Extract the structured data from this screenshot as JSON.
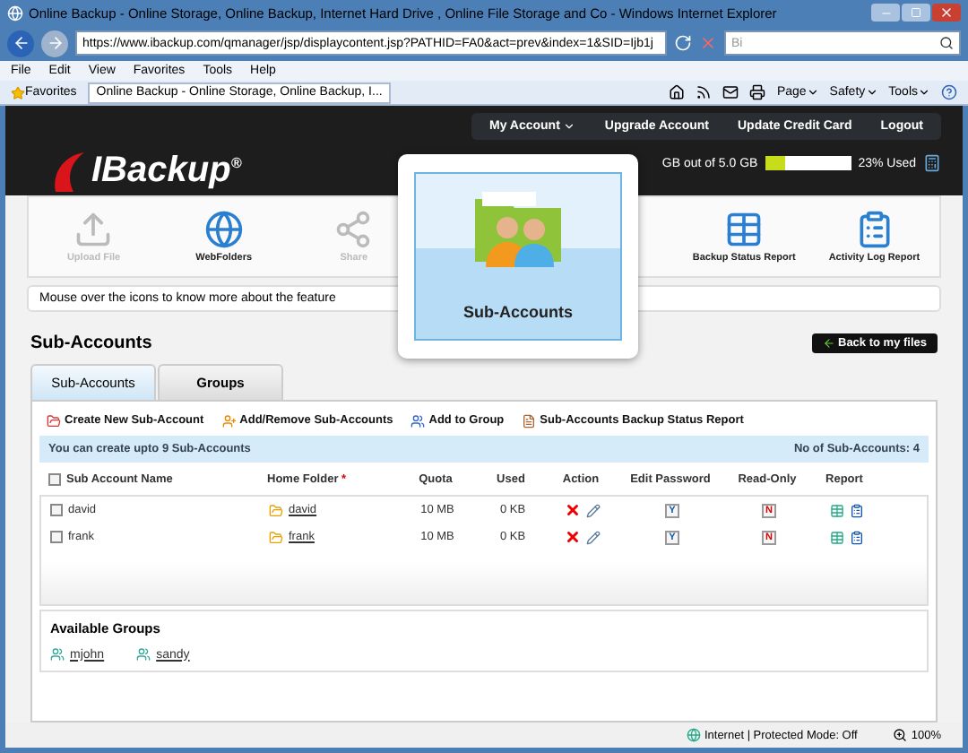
{
  "window": {
    "title": "Online Backup - Online Storage, Online Backup, Internet Hard Drive , Online File Storage and Co - Windows Internet Explorer"
  },
  "address_bar": {
    "url": "https://www.ibackup.com/qmanager/jsp/displaycontent.jsp?PATHID=FA0&act=prev&index=1&SID=Ijb1j",
    "search_placeholder": "Bi"
  },
  "menu": [
    "File",
    "Edit",
    "View",
    "Favorites",
    "Tools",
    "Help"
  ],
  "favorites_bar": {
    "favorites": "Favorites",
    "tab": "Online Backup - Online Storage, Online Backup, I...",
    "commands": [
      "Page",
      "Safety",
      "Tools"
    ]
  },
  "site": {
    "logo": "IBackup",
    "logo_mark": "®",
    "nav": [
      {
        "label": "My Account",
        "dropdown": true
      },
      {
        "label": "Upgrade Account",
        "dropdown": false
      },
      {
        "label": "Update Credit Card",
        "dropdown": false
      },
      {
        "label": "Logout",
        "dropdown": false
      }
    ],
    "storage": {
      "text": "GB out of 5.0 GB",
      "level": 0.23,
      "reading": "23% Used"
    }
  },
  "features": [
    {
      "label": "Upload File",
      "kind": "upload",
      "disabled": true
    },
    {
      "label": "WebFolders",
      "kind": "webfolders",
      "disabled": false
    },
    {
      "label": "Share",
      "kind": "share",
      "disabled": true
    },
    {
      "label": "Backup Status Report",
      "kind": "backup",
      "disabled": false
    },
    {
      "label": "Activity Log Report",
      "kind": "log",
      "disabled": false
    }
  ],
  "hint": "Mouse over the icons to know more about the feature",
  "popup": {
    "label": "Sub-Accounts"
  },
  "page_title": "Sub-Accounts",
  "back_button": "Back to my files",
  "tabs": [
    {
      "label": "Sub-Accounts",
      "selected": true
    },
    {
      "label": "Groups",
      "selected": false
    }
  ],
  "actions": [
    {
      "label": "Create New Sub-Account",
      "kind": "create"
    },
    {
      "label": "Add/Remove Sub-Accounts",
      "kind": "addremove"
    },
    {
      "label": "Add to Group",
      "kind": "group"
    },
    {
      "label": "Sub-Accounts Backup Status Report",
      "kind": "report"
    }
  ],
  "info": {
    "left": "You can create upto 9 Sub-Accounts",
    "right": "No of Sub-Accounts: 4"
  },
  "table": {
    "select_all_checked": false,
    "columns": [
      "Sub Account Name",
      "Home Folder",
      "Quota",
      "Used",
      "Action",
      "Edit Password",
      "Read-Only",
      "Report"
    ],
    "required_mark": "*",
    "rows": [
      {
        "name": "david",
        "checked": false,
        "folder": "david",
        "quota": "10 MB",
        "used": "0 KB",
        "password": "Y",
        "read_only": "N"
      },
      {
        "name": "frank",
        "checked": false,
        "folder": "frank",
        "quota": "10 MB",
        "used": "0 KB",
        "password": "Y",
        "read_only": "N"
      }
    ]
  },
  "groups": {
    "title": "Available Groups",
    "items": [
      "mjohn",
      "sandy"
    ]
  },
  "status_bar": {
    "zone": "Internet | Protected Mode: Off",
    "zoom": "100%"
  }
}
